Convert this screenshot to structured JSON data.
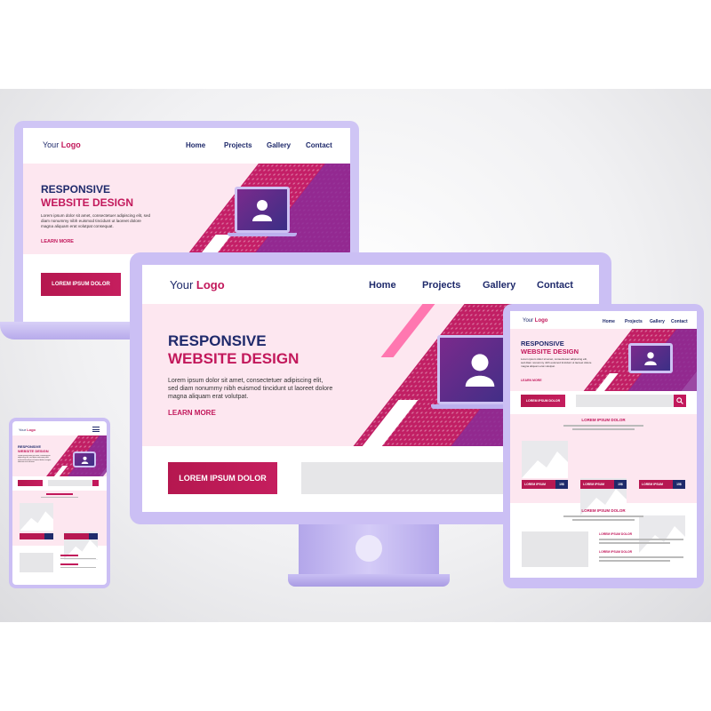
{
  "logo": {
    "prefix": "Your",
    "brand": "Logo"
  },
  "nav": [
    "Home",
    "Projects",
    "Gallery",
    "Contact"
  ],
  "hero": {
    "line1": "RESPONSIVE",
    "line2": "WEBSITE DESIGN",
    "body": "Lorem ipsum dolor sit amet, consectetuer adipiscing elit, sed diam nonummy nibh euismod tincidunt ut laoreet dolore magna aliquam erat volutpat.",
    "body_short": "Lorem ipsum dolor sit amet, consectetuer adipiscing elit, sed diam nonummy nibh euismod tincidunt ut laoreet dolore magna aliquam erat volutpat consequat.",
    "link": "LEARN MORE"
  },
  "cta": "LOREM IPSUM DOLOR",
  "section_title": "LOREM IPSUM DOLOR",
  "card": {
    "label": "LOREM IPSUM",
    "price": "15$"
  },
  "list_title": "LOREM IPSUM DOLOR",
  "colors": {
    "accent": "#c2185b",
    "navy": "#1f2a6b",
    "device": "#c8bdf3"
  }
}
